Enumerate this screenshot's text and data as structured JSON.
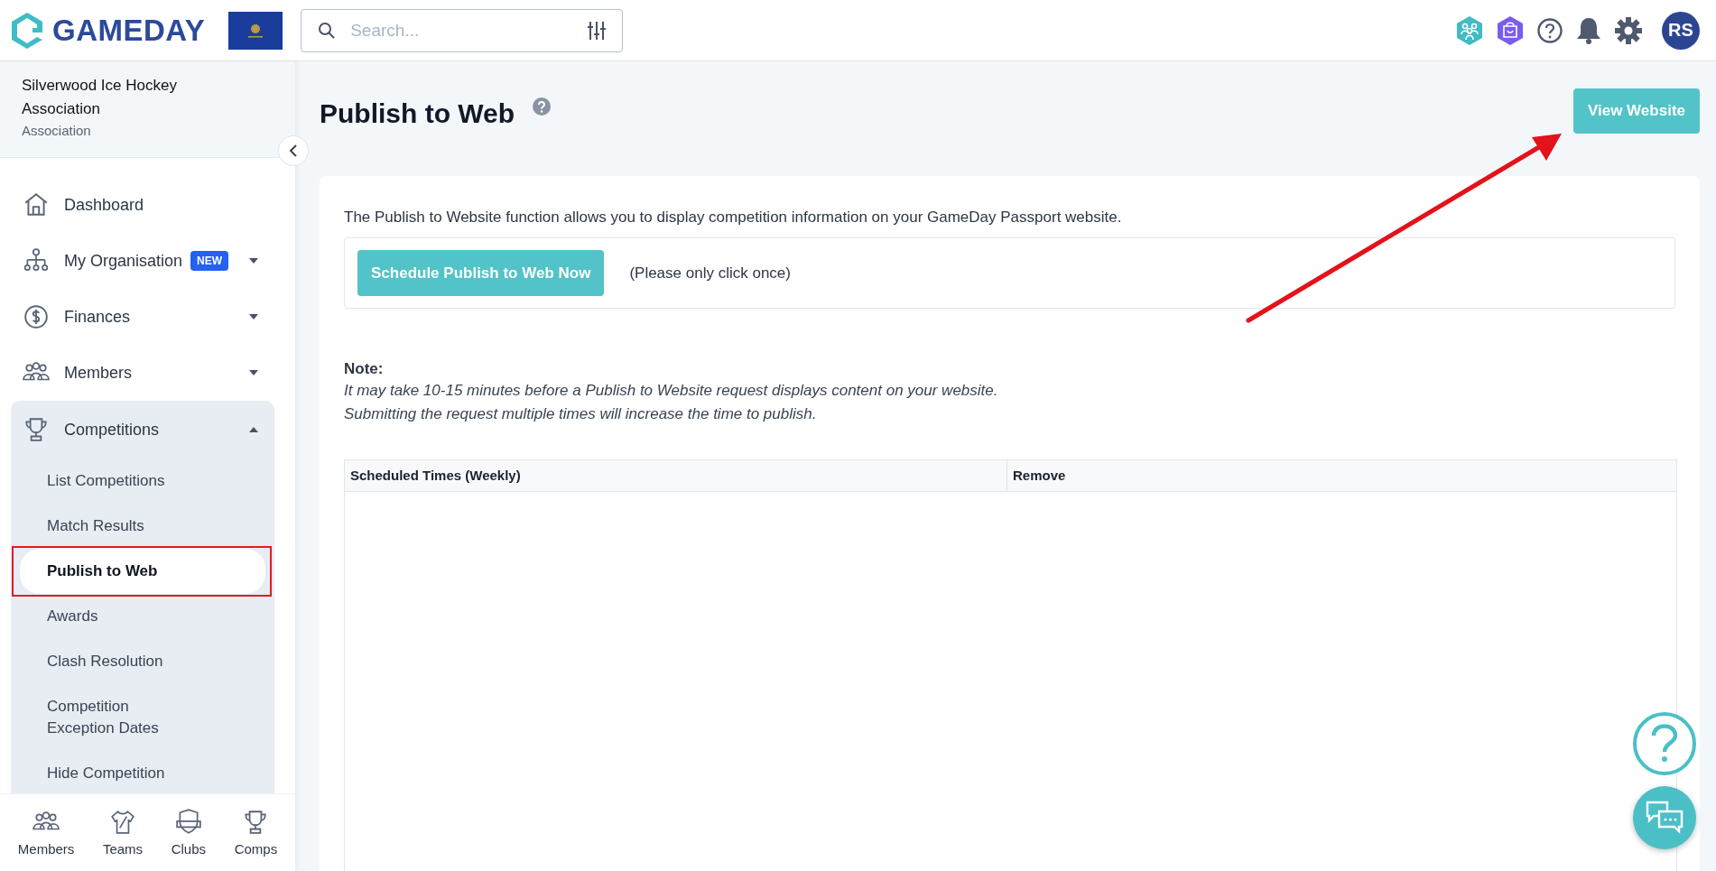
{
  "header": {
    "logo": "GAMEDAY",
    "search": {
      "placeholder": "Search..."
    },
    "avatar": "RS"
  },
  "sidebar": {
    "org_name": "Silverwood Ice Hockey Association",
    "org_type": "Association",
    "items": [
      {
        "kind": "link",
        "label": "Dashboard"
      },
      {
        "kind": "menu",
        "label": "My Organisation",
        "badge": "NEW",
        "expanded": false
      },
      {
        "kind": "menu",
        "label": "Finances",
        "expanded": false
      },
      {
        "kind": "menu",
        "label": "Members",
        "expanded": false
      },
      {
        "kind": "menu",
        "label": "Competitions",
        "expanded": true,
        "children": [
          {
            "label": "List Competitions",
            "selected": false
          },
          {
            "label": "Match Results",
            "selected": false
          },
          {
            "label": "Publish to Web",
            "selected": true
          },
          {
            "label": "Awards",
            "selected": false
          },
          {
            "label": "Clash Resolution",
            "selected": false
          },
          {
            "label": "Competition Exception Dates",
            "selected": false
          },
          {
            "label": "Hide Competition",
            "selected": false
          }
        ]
      }
    ],
    "bottom_nav": [
      "Members",
      "Teams",
      "Clubs",
      "Comps"
    ]
  },
  "main": {
    "title": "Publish to Web",
    "view_button": "View Website",
    "description": "The Publish to Website function allows you to display competition information on your GameDay Passport website.",
    "publish_button": "Schedule Publish to Web Now",
    "publish_hint": "(Please only click once)",
    "note_title": "Note:",
    "note_lines": [
      "It may take 10-15 minutes before a Publish to Website request displays content on your website.",
      "Submitting the request multiple times will increase the time to publish."
    ],
    "table": {
      "columns": [
        "Scheduled Times (Weekly)",
        "Remove"
      ]
    }
  }
}
